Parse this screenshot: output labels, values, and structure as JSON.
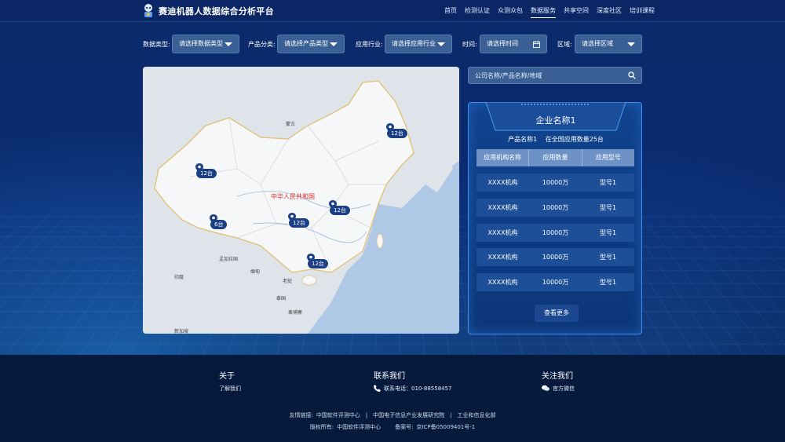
{
  "header": {
    "title": "赛迪机器人数据综合分析平台",
    "nav": [
      "首页",
      "检测认证",
      "众测众包",
      "数据服务",
      "共享空间",
      "深度社区",
      "培训课程"
    ],
    "active_index": 3
  },
  "filters": {
    "data_type": {
      "label": "数据类型:",
      "value": "请选择数据类型"
    },
    "product_category": {
      "label": "产品分类:",
      "value": "请选择产品类型"
    },
    "industry": {
      "label": "应用行业:",
      "value": "请选择应用行业"
    },
    "time": {
      "label": "时间:",
      "value": "请选择时间"
    },
    "region": {
      "label": "区域:",
      "value": "请选择区域"
    }
  },
  "map": {
    "country_label": "中华人民共和国",
    "labels": [
      "蒙古",
      "印度",
      "缅甸",
      "老挝",
      "泰国",
      "柬埔寨",
      "孟加拉国",
      "新加坡"
    ],
    "markers": [
      {
        "count": "12台"
      },
      {
        "count": "12台"
      },
      {
        "count": "6台"
      },
      {
        "count": "12台"
      },
      {
        "count": "12台"
      },
      {
        "count": "12台"
      }
    ]
  },
  "search": {
    "placeholder": "公司名称/产品名称/地域"
  },
  "company": {
    "name": "企业名称1",
    "product": "产品名称1",
    "total": "在全国应用数量25台",
    "columns": [
      "应用机构名称",
      "应用数量",
      "应用型号"
    ],
    "rows": [
      [
        "XXXX机构",
        "10000万",
        "型号1"
      ],
      [
        "XXXX机构",
        "10000万",
        "型号1"
      ],
      [
        "XXXX机构",
        "10000万",
        "型号1"
      ],
      [
        "XXXX机构",
        "10000万",
        "型号1"
      ],
      [
        "XXXX机构",
        "10000万",
        "型号1"
      ]
    ],
    "more": "查看更多"
  },
  "footer": {
    "about": {
      "title": "关于",
      "item": "了解我们"
    },
    "contact": {
      "title": "联系我们",
      "phone": "联系电话：010-88558457"
    },
    "follow": {
      "title": "关注我们",
      "wechat": "官方微信"
    },
    "links_label": "友情链接:",
    "links": [
      "中国软件评测中心",
      "中国电子信息产业发展研究院",
      "工业和信息化部"
    ],
    "copyright_label": "版权所有:",
    "copyright_owner": "中国软件评测中心",
    "icp_label": "备案号:",
    "icp": "京ICP备05009401号-1"
  },
  "colors": {
    "header_bg": "#0a2664",
    "accent": "#3f8df0",
    "map_land": "#f6f7f9",
    "map_sea": "#aec8e6",
    "footer_bg": "#051a3d"
  }
}
